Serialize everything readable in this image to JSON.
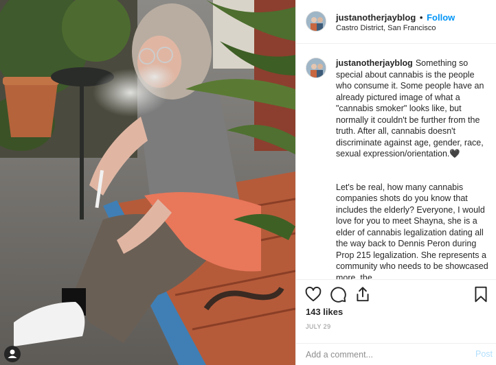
{
  "post": {
    "username": "justanotherjayblog",
    "dot": "•",
    "follow_label": "Follow",
    "location": "Castro District, San Francisco"
  },
  "caption": {
    "username": "justanotherjayblog",
    "paragraph1": "Something so special about cannabis is the people who consume it. Some people have an already pictured image of what a \"cannabis smoker\" looks like, but normally it couldn't be further from the truth. After all, cannabis doesn't discriminate against age, gender, race, sexual expression/orientation.🖤",
    "paragraph2": "Let's be real, how many cannabis companies shots do you know that includes the elderly? Everyone, I would love for you to meet Shayna, she is a elder of cannabis legalization dating all the way back to Dennis Peron during Prop 215 legalization. She represents a community who needs to be showcased more. the"
  },
  "actions": {
    "like_icon": "heart-icon",
    "comment_icon": "comment-icon",
    "share_icon": "share-icon",
    "save_icon": "bookmark-icon"
  },
  "likes_text": "143 likes",
  "date_text": "JULY 29",
  "comment": {
    "placeholder": "Add a comment...",
    "post_label": "Post"
  },
  "colors": {
    "accent": "#0095f6",
    "post_disabled": "#b2dffc",
    "muted": "#8e8e8e",
    "border": "#efefef"
  }
}
